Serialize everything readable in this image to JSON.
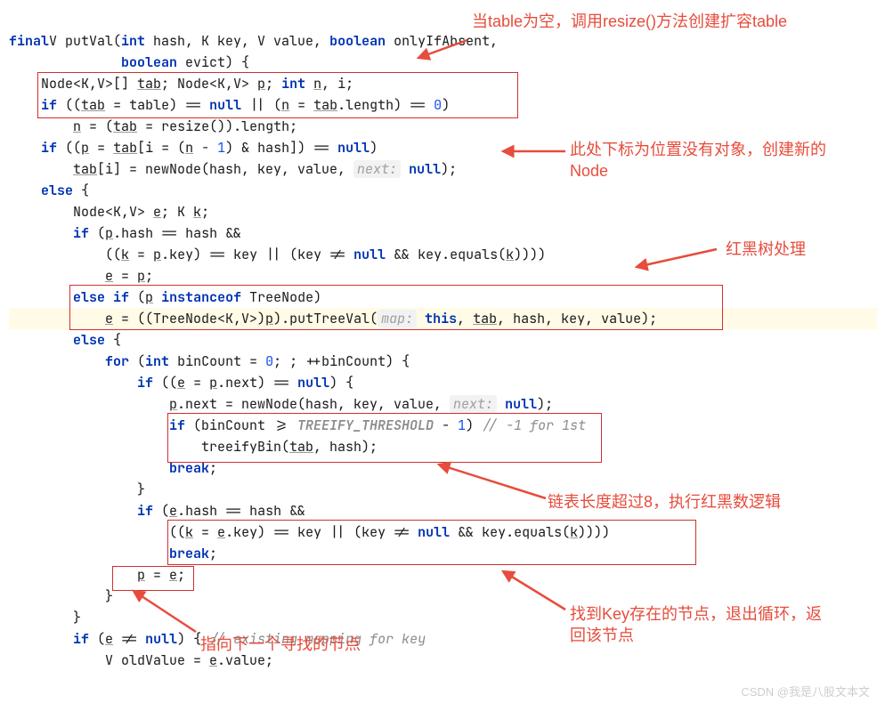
{
  "code": {
    "l1a": "final",
    "l1b": "V putVal(",
    "l1c": "int",
    "l1d": " hash, K key, V value, ",
    "l1e": "boolean",
    "l1f": " onlyIfAbsent,",
    "l2a": "boolean",
    "l2b": " evict) {",
    "l3": "    Node<K,V>[] ",
    "l3u": "tab",
    "l3b": "; Node<K,V> ",
    "l3u2": "p",
    "l3c": "; ",
    "l3d": "int",
    "l3e": " ",
    "l3u3": "n",
    "l3f": ", i;",
    "l4a": "if",
    "l4b": " ((",
    "l4u1": "tab",
    "l4c": " = table) == ",
    "l4d": "null",
    "l4e": " || (",
    "l4u2": "n",
    "l4f": " = ",
    "l4u3": "tab",
    "l4g": ".length) == ",
    "l4h": "0",
    "l4i": ")",
    "l5a": "n",
    "l5b": " = (",
    "l5c": "tab",
    "l5d": " = resize()).length;",
    "l6a": "if",
    "l6b": " ((",
    "l6u1": "p",
    "l6c": " = ",
    "l6u2": "tab",
    "l6d": "[i = (",
    "l6u3": "n",
    "l6e": " - ",
    "l6f": "1",
    "l6g": ") & hash]) == ",
    "l6h": "null",
    "l6i": ")",
    "l7u1": "tab",
    "l7a": "[i] = newNode(hash, key, value, ",
    "l7hint": "next:",
    "l7b": " ",
    "l7c": "null",
    "l7d": ");",
    "l8a": "else",
    "l8b": " {",
    "l9a": "        Node<K,V> ",
    "l9u1": "e",
    "l9b": "; K ",
    "l9u2": "k",
    "l9c": ";",
    "l10a": "if",
    "l10b": " (",
    "l10u1": "p",
    "l10c": ".hash == hash &&",
    "l11a": "            ((",
    "l11u1": "k",
    "l11b": " = ",
    "l11u2": "p",
    "l11c": ".key) == key || (key != ",
    "l11d": "null",
    "l11e": " && key.equals(",
    "l11u3": "k",
    "l11f": "))))",
    "l12u1": "e",
    "l12a": " = ",
    "l12u2": "p",
    "l12b": ";",
    "l13a": "else if",
    "l13b": " (",
    "l13u1": "p",
    "l13c": " ",
    "l13d": "instanceof",
    "l13e": " TreeNode)",
    "l14u1": "e",
    "l14a": " = ((TreeNode<K,V>)",
    "l14u2": "p",
    "l14b": ").putTreeVal(",
    "l14hint": "map:",
    "l14c": " ",
    "l14d": "this",
    "l14e": ", ",
    "l14u3": "tab",
    "l14f": ", hash, key, value);",
    "l15a": "else",
    "l15b": " {",
    "l16a": "for",
    "l16b": " (",
    "l16c": "int",
    "l16d": " binCount = ",
    "l16e": "0",
    "l16f": "; ; ++binCount) {",
    "l17a": "if",
    "l17b": " ((",
    "l17u1": "e",
    "l17c": " = ",
    "l17u2": "p",
    "l17d": ".next) == ",
    "l17e": "null",
    "l17f": ") {",
    "l18u1": "p",
    "l18a": ".next = newNode(hash, key, value, ",
    "l18hint": "next:",
    "l18b": " ",
    "l18c": "null",
    "l18d": ");",
    "l19a": "if",
    "l19b": " (binCount >= ",
    "l19c": "TREEIFY_THRESHOLD",
    "l19d": " - ",
    "l19e": "1",
    "l19f": ") ",
    "l19g": "// -1 for 1st",
    "l20a": "                        treeifyBin(",
    "l20u1": "tab",
    "l20b": ", hash);",
    "l21a": "break",
    "l21b": ";",
    "l22a": "                }",
    "l23a": "if",
    "l23b": " (",
    "l23u1": "e",
    "l23c": ".hash == hash &&",
    "l24a": "                    ((",
    "l24u1": "k",
    "l24b": " = ",
    "l24u2": "e",
    "l24c": ".key) == key || (key != ",
    "l24d": "null",
    "l24e": " && key.equals(",
    "l24u3": "k",
    "l24f": "))))",
    "l25a": "break",
    "l25b": ";",
    "l26u1": "p",
    "l26a": " = ",
    "l26u2": "e",
    "l26b": ";",
    "l27a": "            }",
    "l28a": "        }",
    "l29a": "if",
    "l29b": " (",
    "l29u1": "e",
    "l29c": " != ",
    "l29d": "null",
    "l29e": ") { ",
    "l29f": "// existing mapping for key",
    "l30a": "            V oldValue = ",
    "l30u1": "e",
    "l30b": ".value;"
  },
  "annotations": {
    "a1": "当table为空，调用resize()方法创建扩容table",
    "a2": "此处下标为位置没有对象，创建新的Node",
    "a3": "红黑树处理",
    "a4": "链表长度超过8，执行红黑数逻辑",
    "a5": "找到Key存在的节点，退出循环，返回该节点",
    "a6": "指向下一个寻找的节点"
  },
  "watermark": "CSDN @我是八股文本文"
}
